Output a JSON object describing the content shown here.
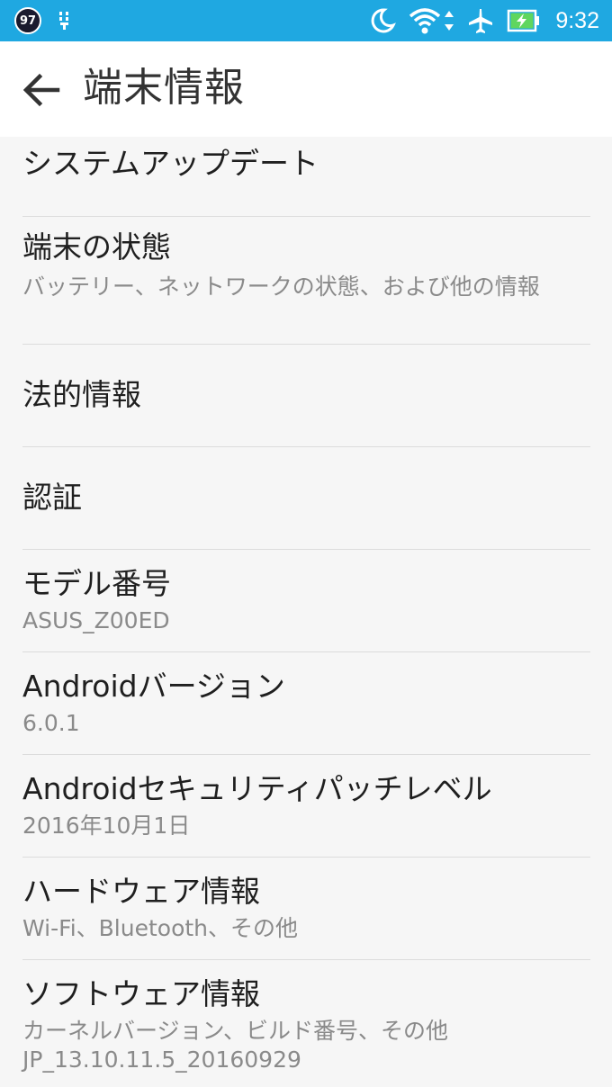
{
  "status_bar": {
    "badge": "97",
    "time": "9:32",
    "colors": {
      "background": "#1fa8e1",
      "text": "#ffffff"
    },
    "icons": [
      "usb-debug-icon",
      "moon-icon",
      "wifi-icon",
      "data-arrows-icon",
      "airplane-icon",
      "battery-charging-icon"
    ]
  },
  "app_bar": {
    "title": "端末情報",
    "back_icon": "arrow-left-icon"
  },
  "items": [
    {
      "title": "システムアップデート",
      "subtitle": ""
    },
    {
      "title": "端末の状態",
      "subtitle": "バッテリー、ネットワークの状態、および他の情報"
    },
    {
      "title": "法的情報",
      "subtitle": ""
    },
    {
      "title": "認証",
      "subtitle": ""
    },
    {
      "title": "モデル番号",
      "subtitle": "ASUS_Z00ED"
    },
    {
      "title": "Androidバージョン",
      "subtitle": "6.0.1"
    },
    {
      "title": "Androidセキュリティパッチレベル",
      "subtitle": "2016年10月1日"
    },
    {
      "title": "ハードウェア情報",
      "subtitle": "Wi-Fi、Bluetooth、その他"
    },
    {
      "title": "ソフトウェア情報",
      "subtitle": "カーネルバージョン、ビルド番号、その他",
      "subtitle2": "JP_13.10.11.5_20160929"
    }
  ]
}
